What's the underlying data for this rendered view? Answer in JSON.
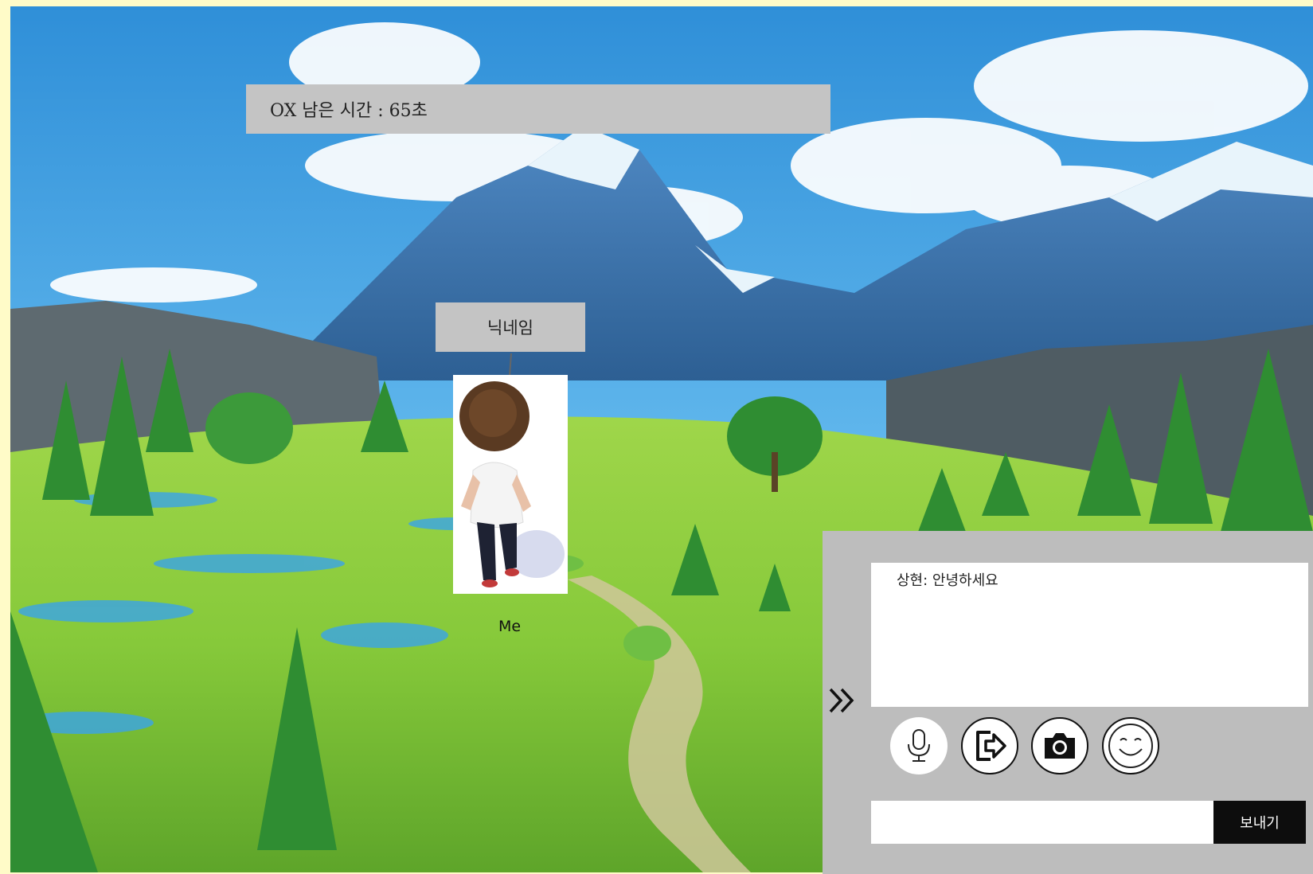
{
  "hud": {
    "timer_text": "OX 남은 시간 : 65초"
  },
  "player": {
    "nickname": "닉네임",
    "self_label": "Me"
  },
  "chat": {
    "messages": [
      {
        "text": "상현: 안녕하세요"
      }
    ],
    "input_value": "",
    "send_label": "보내기",
    "toggle_icon": "double-chevron-right-icon",
    "tools": [
      "microphone-icon",
      "exit-icon",
      "camera-icon",
      "emoji-icon"
    ]
  },
  "colors": {
    "page_border": "#fffbc8",
    "panel": "#bdbdbd",
    "send_button": "#0d0d0d"
  }
}
